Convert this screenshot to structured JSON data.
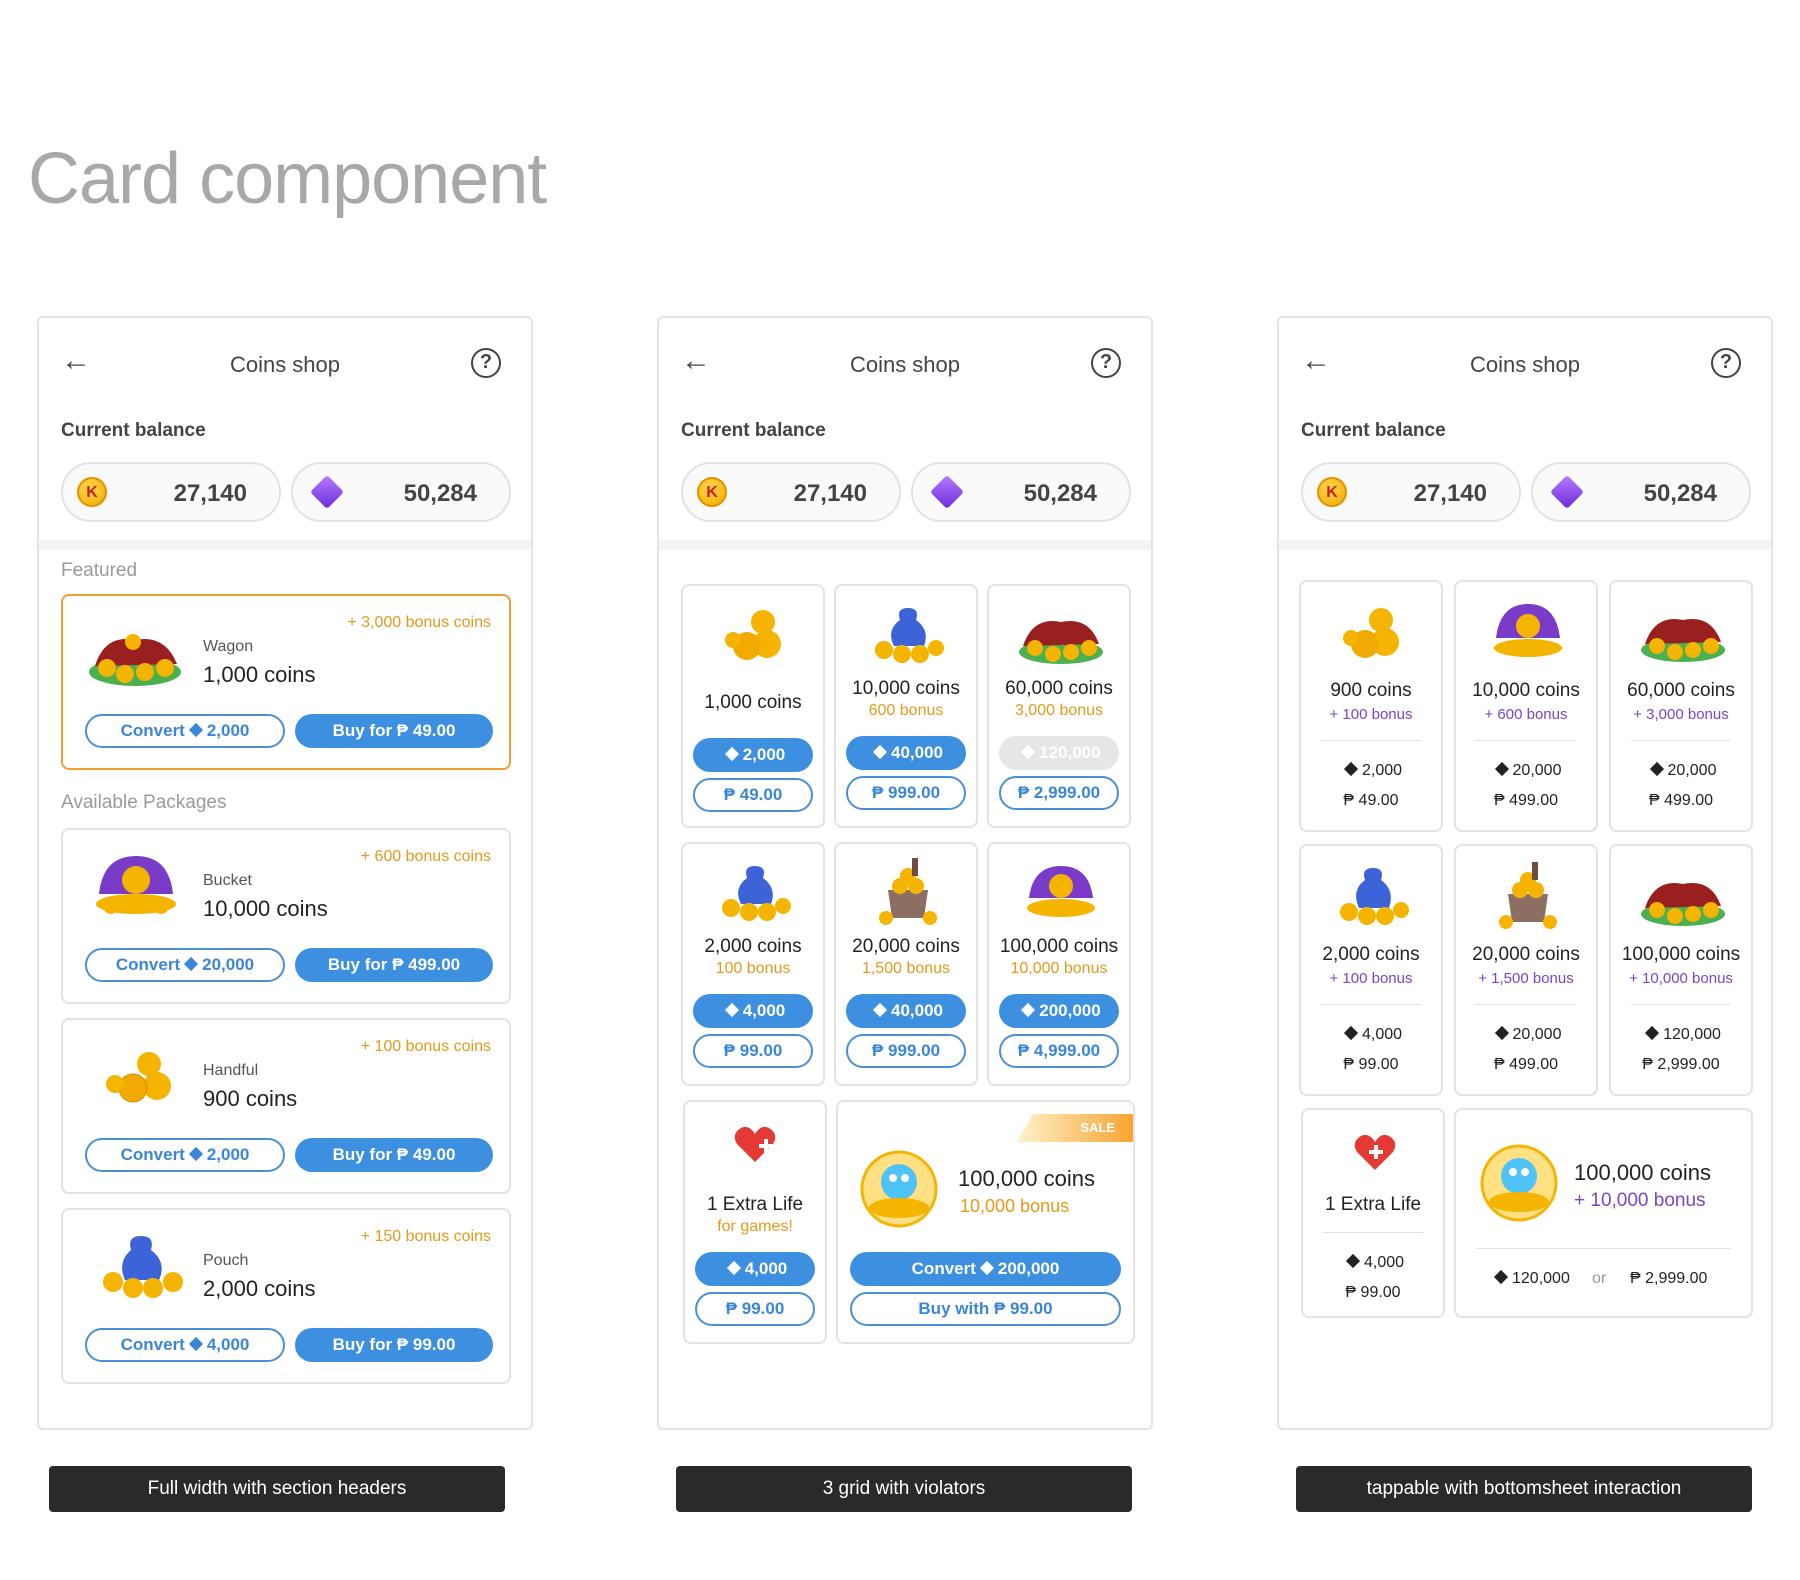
{
  "page_title": "Card component",
  "appbar": {
    "title": "Coins shop",
    "help": "?"
  },
  "balance": {
    "label": "Current balance",
    "coins": "27,140",
    "gems": "50,284"
  },
  "captions": [
    "Full width with section headers",
    "3 grid with violators",
    "tappable with bottomsheet interaction"
  ],
  "v1": {
    "featured_header": "Featured",
    "available_header": "Available Packages",
    "featured": {
      "bonus": "+ 3,000 bonus coins",
      "name": "Wagon",
      "coins": "1,000 coins",
      "convert": "Convert",
      "convert_val": "2,000",
      "buy": "Buy for ₱ 49.00"
    },
    "packages": [
      {
        "bonus": "+ 600 bonus coins",
        "name": "Bucket",
        "coins": "10,000 coins",
        "convert": "Convert",
        "convert_val": "20,000",
        "buy": "Buy for ₱ 499.00"
      },
      {
        "bonus": "+ 100 bonus coins",
        "name": "Handful",
        "coins": "900 coins",
        "convert": "Convert",
        "convert_val": "2,000",
        "buy": "Buy for ₱ 49.00"
      },
      {
        "bonus": "+ 150 bonus coins",
        "name": "Pouch",
        "coins": "2,000 coins",
        "convert": "Convert",
        "convert_val": "4,000",
        "buy": "Buy for ₱ 99.00"
      }
    ]
  },
  "v2": {
    "cards": [
      {
        "coins": "1,000 coins",
        "bonus": "",
        "gem": "2,000",
        "price": "₱ 49.00"
      },
      {
        "coins": "10,000 coins",
        "bonus": "600 bonus",
        "gem": "40,000",
        "price": "₱ 999.00"
      },
      {
        "coins": "60,000 coins",
        "bonus": "3,000 bonus",
        "gem": "120,000",
        "price": "₱ 2,999.00"
      },
      {
        "coins": "2,000 coins",
        "bonus": "100 bonus",
        "gem": "4,000",
        "price": "₱ 99.00"
      },
      {
        "coins": "20,000 coins",
        "bonus": "1,500 bonus",
        "gem": "40,000",
        "price": "₱ 999.00"
      },
      {
        "coins": "100,000 coins",
        "bonus": "10,000 bonus",
        "gem": "200,000",
        "price": "₱ 4,999.00"
      }
    ],
    "life": {
      "title": "1 Extra Life",
      "sub": "for games!",
      "gem": "4,000",
      "price": "₱ 99.00"
    },
    "sale": {
      "tag": "SALE",
      "coins": "100,000 coins",
      "bonus": "10,000 bonus",
      "convert": "Convert",
      "convert_val": "200,000",
      "buy": "Buy with  ₱ 99.00"
    }
  },
  "v3": {
    "cards": [
      {
        "coins": "900 coins",
        "bonus": "+ 100 bonus",
        "gem": "2,000",
        "price": "₱  49.00"
      },
      {
        "coins": "10,000 coins",
        "bonus": "+ 600 bonus",
        "gem": "20,000",
        "price": "₱ 499.00"
      },
      {
        "coins": "60,000 coins",
        "bonus": "+ 3,000 bonus",
        "gem": "20,000",
        "price": "₱ 499.00"
      },
      {
        "coins": "2,000 coins",
        "bonus": "+ 100 bonus",
        "gem": "4,000",
        "price": "₱  99.00"
      },
      {
        "coins": "20,000 coins",
        "bonus": "+ 1,500 bonus",
        "gem": "20,000",
        "price": "₱ 499.00"
      },
      {
        "coins": "100,000 coins",
        "bonus": "+ 10,000 bonus",
        "gem": "120,000",
        "price": "₱ 2,999.00"
      }
    ],
    "life": {
      "title": "1 Extra Life",
      "gem": "4,000",
      "price": "₱  99.00"
    },
    "big": {
      "coins": "100,000 coins",
      "bonus": "+ 10,000 bonus",
      "gem": "120,000",
      "or": "or",
      "price": "₱ 2,999.00"
    }
  }
}
